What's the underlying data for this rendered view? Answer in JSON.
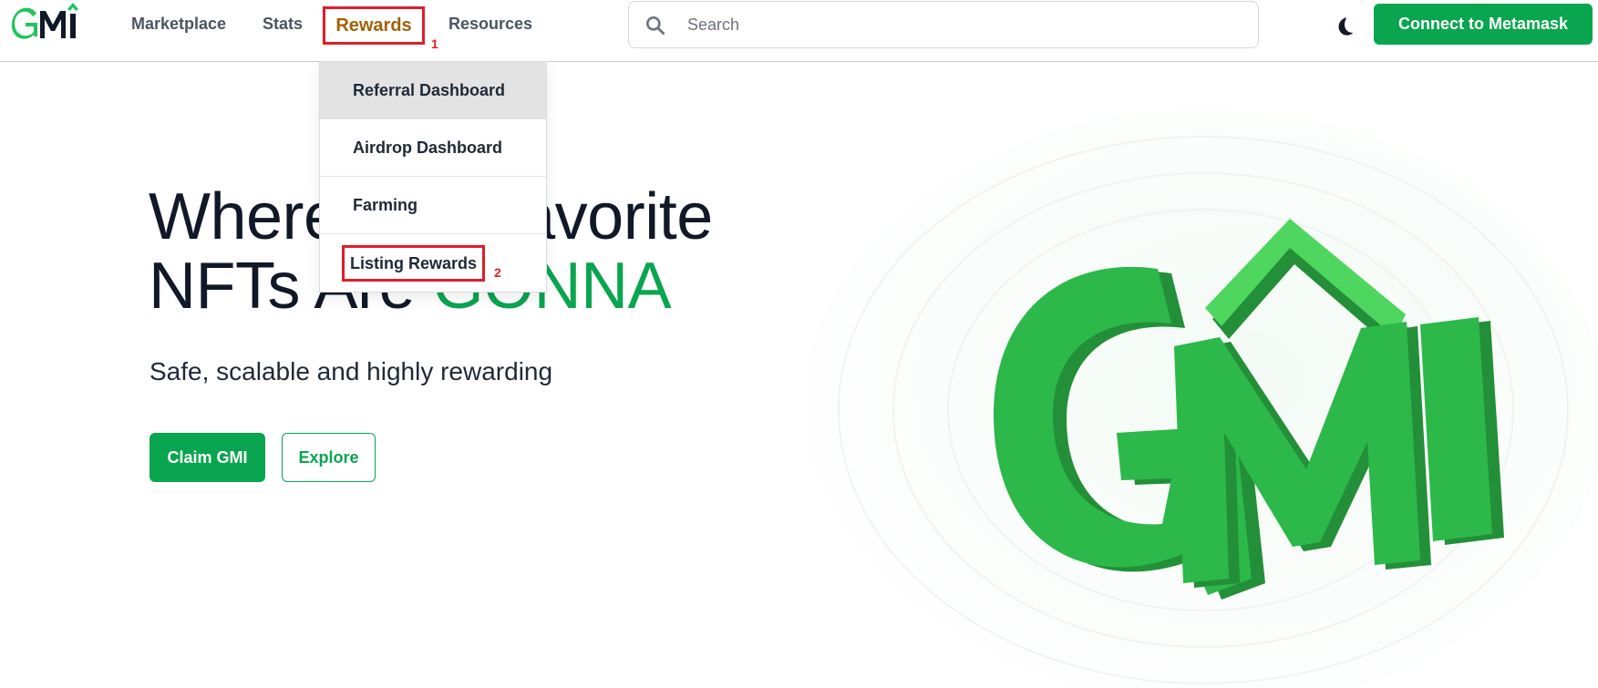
{
  "header": {
    "logo_text": "GMI",
    "nav": [
      {
        "label": "Marketplace"
      },
      {
        "label": "Stats"
      },
      {
        "label": "Rewards"
      },
      {
        "label": "Resources"
      }
    ],
    "annotations": {
      "rewards": "1",
      "listing_rewards": "2"
    },
    "search": {
      "placeholder": "Search",
      "value": ""
    },
    "theme_toggle_icon": "moon-icon",
    "connect_button": "Connect to Metamask"
  },
  "rewards_menu": {
    "items": [
      {
        "label": "Referral Dashboard",
        "highlighted": true
      },
      {
        "label": "Airdrop Dashboard"
      },
      {
        "label": "Farming"
      },
      {
        "label": "Listing Rewards"
      }
    ]
  },
  "hero": {
    "title_line1": "Where your favorite",
    "title_line2_prefix": "NFTs Are ",
    "title_line2_accent": "GONNA",
    "subtitle": "Safe, scalable and highly rewarding",
    "claim_button": "Claim GMI",
    "explore_button": "Explore",
    "art_text": "GMI"
  },
  "colors": {
    "brand_green": "#0aa54f",
    "art_green": "#2db84a",
    "annotation_red": "#e11d2a",
    "rewards_text": "#a16207"
  }
}
